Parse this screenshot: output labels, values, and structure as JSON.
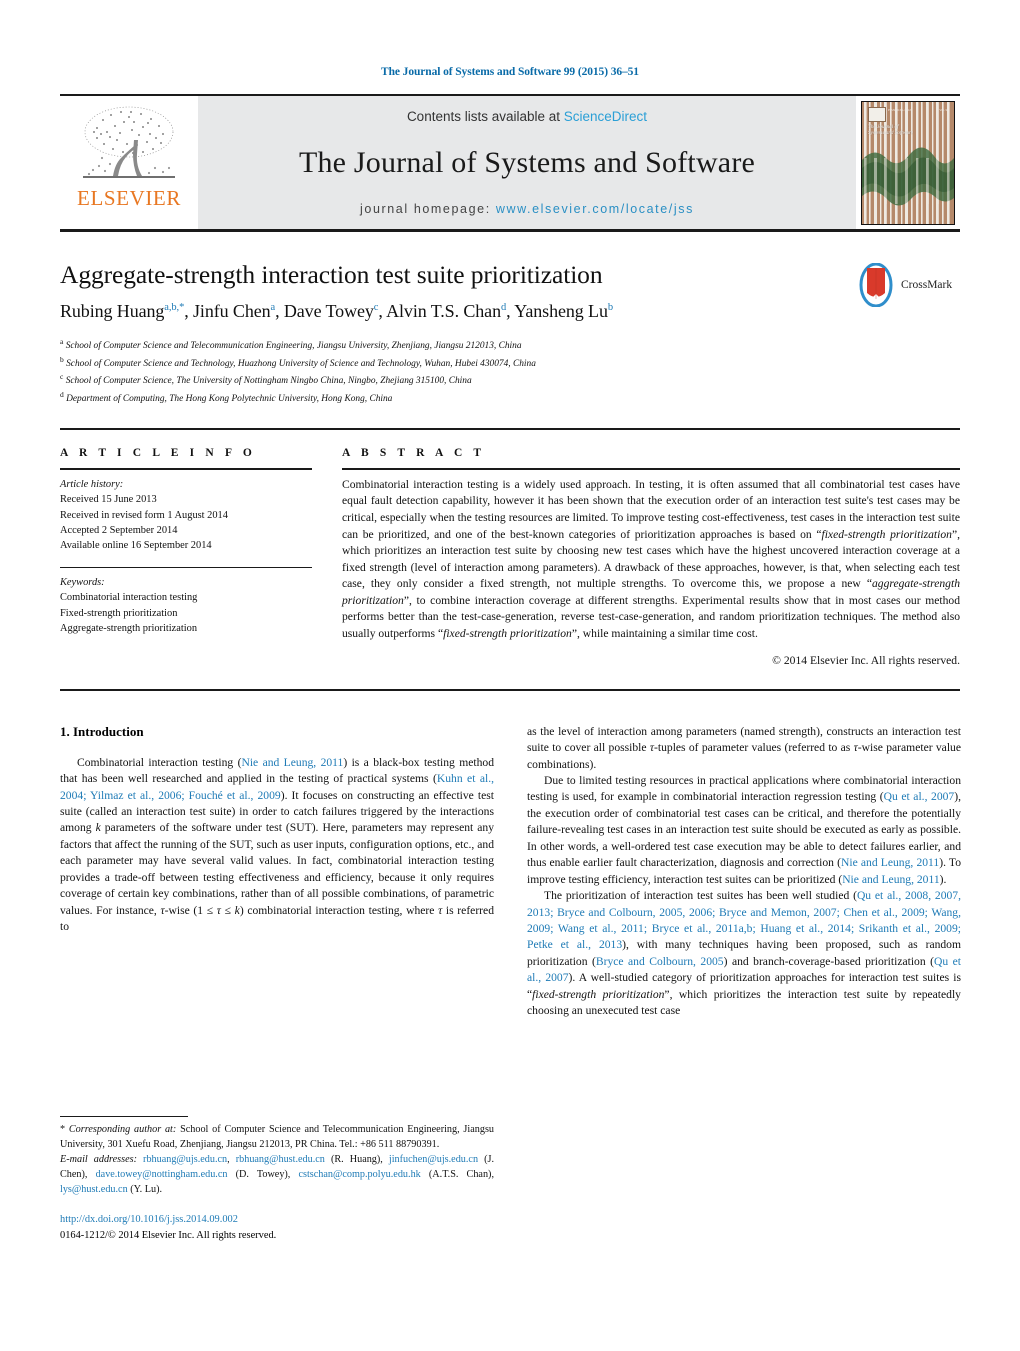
{
  "running_head": "The Journal of Systems and Software 99 (2015) 36–51",
  "masthead": {
    "publisher_wordmark": "ELSEVIER",
    "contents_prefix": "Contents lists available at ",
    "contents_link": "ScienceDirect",
    "journal_title": "The Journal of Systems and Software",
    "homepage_prefix": "journal homepage: ",
    "homepage_url": "www.elsevier.com/locate/jss",
    "cover": {
      "title_line1": "The Journal of",
      "title_line2": "Systems and Software",
      "top_left": "ISSN 0164-1212",
      "top_right": "Vol. 99"
    }
  },
  "article": {
    "title": "Aggregate-strength interaction test suite prioritization",
    "authors_html": "Rubing Huang<sup>a,b,</sup><sup>*</sup>, Jinfu Chen<sup>a</sup>, Dave Towey<sup>c</sup>, Alvin T.S. Chan<sup>d</sup>, Yansheng Lu<sup>b</sup>",
    "affiliations": [
      "School of Computer Science and Telecommunication Engineering, Jiangsu University, Zhenjiang, Jiangsu 212013, China",
      "School of Computer Science and Technology, Huazhong University of Science and Technology, Wuhan, Hubei 430074, China",
      "School of Computer Science, The University of Nottingham Ningbo China, Ningbo, Zhejiang 315100, China",
      "Department of Computing, The Hong Kong Polytechnic University, Hong Kong, China"
    ],
    "affiliation_marks": [
      "a",
      "b",
      "c",
      "d"
    ],
    "crossmark_label": "CrossMark"
  },
  "article_info": {
    "heading": "A R T I C L E   I N F O",
    "history_label": "Article history:",
    "history": [
      "Received 15 June 2013",
      "Received in revised form 1 August 2014",
      "Accepted 2 September 2014",
      "Available online 16 September 2014"
    ],
    "keywords_label": "Keywords:",
    "keywords": [
      "Combinatorial interaction testing",
      "Fixed-strength prioritization",
      "Aggregate-strength prioritization"
    ]
  },
  "abstract": {
    "heading": "A B S T R A C T",
    "paragraph_html": "Combinatorial interaction testing is a widely used approach. In testing, it is often assumed that all combinatorial test cases have equal fault detection capability, however it has been shown that the execution order of an interaction test suite's test cases may be critical, especially when the testing resources are limited. To improve testing cost-effectiveness, test cases in the interaction test suite can be prioritized, and one of the best-known categories of prioritization approaches is based on “<i>fixed-strength prioritization</i>”, which prioritizes an interaction test suite by choosing new test cases which have the highest uncovered interaction coverage at a fixed strength (level of interaction among parameters). A drawback of these approaches, however, is that, when selecting each test case, they only consider a fixed strength, not multiple strengths. To overcome this, we propose a new “<i>aggregate-strength prioritization</i>”, to combine interaction coverage at different strengths. Experimental results show that in most cases our method performs better than the test-case-generation, reverse test-case-generation, and random prioritization techniques. The method also usually outperforms “<i>fixed-strength prioritization</i>”, while maintaining a similar time cost.",
    "copyright": "© 2014 Elsevier Inc. All rights reserved."
  },
  "body": {
    "section_number_title": "1.  Introduction",
    "left_para_1_html": "Combinatorial interaction testing (<span class=\"cite\">Nie and Leung, 2011</span>) is a black-box testing method that has been well researched and applied in the testing of practical systems (<span class=\"cite\">Kuhn et al., 2004; Yilmaz et al., 2006; Fouché et al., 2009</span>). It focuses on constructing an effective test suite (called an interaction test suite) in order to catch failures triggered by the interactions among <i>k</i> parameters of the software under test (SUT). Here, parameters may represent any factors that affect the running of the SUT, such as user inputs, configuration options, etc., and each parameter may have several valid values. In fact, combinatorial interaction testing provides a trade-off between testing effectiveness and efficiency, because it only requires coverage of certain key combinations, rather than of all possible combinations, of parametric values. For instance, <i>τ</i>-wise (1 ≤ <i>τ</i> ≤ <i>k</i>) combinatorial interaction testing, where <i>τ</i> is referred to",
    "right_para_1_html": "as the level of interaction among parameters (named strength), constructs an interaction test suite to cover all possible <i>τ</i>-tuples of parameter values (referred to as <i>τ</i>-wise parameter value combinations).",
    "right_para_2_html": "Due to limited testing resources in practical applications where combinatorial interaction testing is used, for example in combinatorial interaction regression testing (<span class=\"cite\">Qu et al., 2007</span>), the execution order of combinatorial test cases can be critical, and therefore the potentially failure-revealing test cases in an interaction test suite should be executed as early as possible. In other words, a well-ordered test case execution may be able to detect failures earlier, and thus enable earlier fault characterization, diagnosis and correction (<span class=\"cite\">Nie and Leung, 2011</span>). To improve testing efficiency, interaction test suites can be prioritized (<span class=\"cite\">Nie and Leung, 2011</span>).",
    "right_para_3_html": "The prioritization of interaction test suites has been well studied (<span class=\"cite\">Qu et al., 2008, 2007, 2013; Bryce and Colbourn, 2005, 2006; Bryce and Memon, 2007; Chen et al., 2009; Wang, 2009; Wang et al., 2011; Bryce et al., 2011a,b; Huang et al., 2014; Srikanth et al., 2009; Petke et al., 2013</span>), with many techniques having been proposed, such as random prioritization (<span class=\"cite\">Bryce and Colbourn, 2005</span>) and branch-coverage-based prioritization (<span class=\"cite\">Qu et al., 2007</span>). A well-studied category of prioritization approaches for interaction test suites is “<i>fixed-strength prioritization</i>”, which prioritizes the interaction test suite by repeatedly choosing an unexecuted test case"
  },
  "footnote": {
    "corresponding_html": "* <i>Corresponding author at:</i> School of Computer Science and Telecommunication Engineering, Jiangsu University, 301 Xuefu Road, Zhenjiang, Jiangsu 212013, PR China. Tel.: +86 511 88790391.",
    "emails_html": "<i>E-mail addresses:</i> <span class=\"cite\">rbhuang@ujs.edu.cn</span>, <span class=\"cite\">rbhuang@hust.edu.cn</span> (R. Huang), <span class=\"cite\">jinfuchen@ujs.edu.cn</span> (J. Chen), <span class=\"cite\">dave.towey@nottingham.edu.cn</span> (D. Towey), <span class=\"cite\">cstschan@comp.polyu.edu.hk</span> (A.T.S. Chan), <span class=\"cite\">lys@hust.edu.cn</span> (Y. Lu).",
    "doi": "http://dx.doi.org/10.1016/j.jss.2014.09.002",
    "issn_copyright": "0164-1212/© 2014 Elsevier Inc. All rights reserved."
  },
  "colors": {
    "link_blue": "#1f7bb6",
    "sciencedirect_blue": "#2a9fd6",
    "elsevier_orange": "#E87722",
    "masthead_band": "#e7e8e9"
  }
}
